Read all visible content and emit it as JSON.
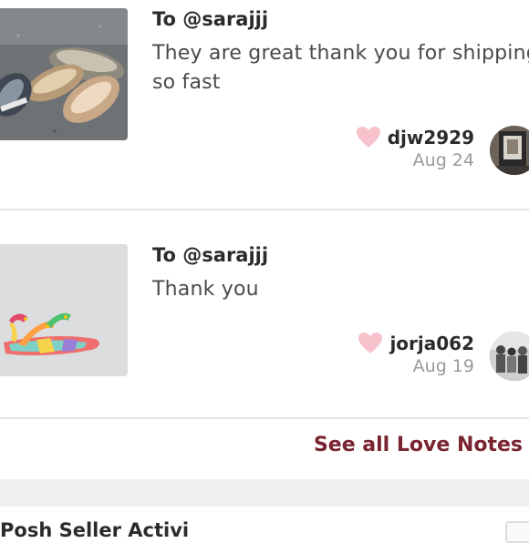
{
  "notes": [
    {
      "to": "To @sarajjj",
      "message": "They are great thank you for shipping so fast",
      "username": "djw2929",
      "date": "Aug 24",
      "image": "metallic-slip-on-sneakers",
      "avatar": "framed-picture-avatar"
    },
    {
      "to": "To @sarajjj",
      "message": "Thank you",
      "username": "jorja062",
      "date": "Aug 19",
      "image": "rainbow-gladiator-sandal",
      "avatar": "group-photo-avatar"
    }
  ],
  "see_all": {
    "label": "See all Love Notes"
  },
  "next_section": {
    "title": "Posh Seller Activi"
  },
  "colors": {
    "link": "#7a2331",
    "heart": "#f7c2cc",
    "date": "#9a9a9a",
    "divider": "#e6e6e6"
  }
}
